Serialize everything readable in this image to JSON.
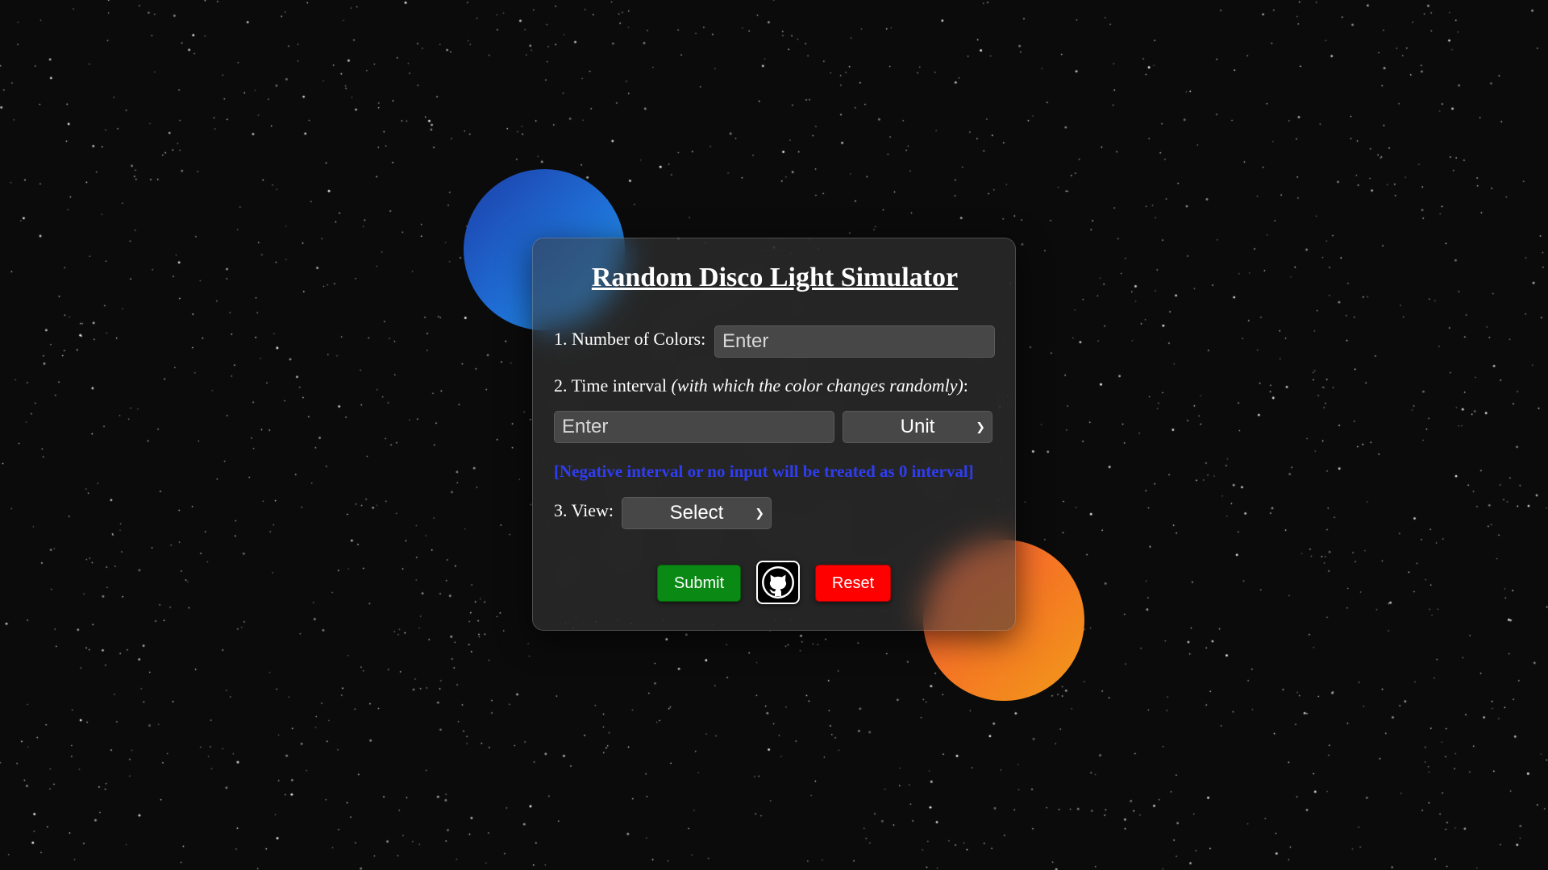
{
  "app": {
    "title": "Random Disco Light Simulator"
  },
  "form": {
    "colors_label": "1. Number of Colors:",
    "colors_placeholder": "Enter",
    "interval_label": "2. Time interval ",
    "interval_label_italic": "(with which the color changes randomly)",
    "interval_label_suffix": ":",
    "interval_placeholder": "Enter",
    "unit_select_value": "Unit",
    "note": "[Negative interval or no input will be treated as 0 interval]",
    "view_label": "3. View:",
    "view_select_value": "Select"
  },
  "buttons": {
    "submit_label": "Submit",
    "reset_label": "Reset",
    "github_icon": "github-icon"
  },
  "colors": {
    "background": "#0b0b0b",
    "note_text": "#2f3df0",
    "submit": "#0a8a14",
    "reset": "#ff0000",
    "orb_blue": "#1f6fd6",
    "orb_orange": "#f47a22"
  }
}
